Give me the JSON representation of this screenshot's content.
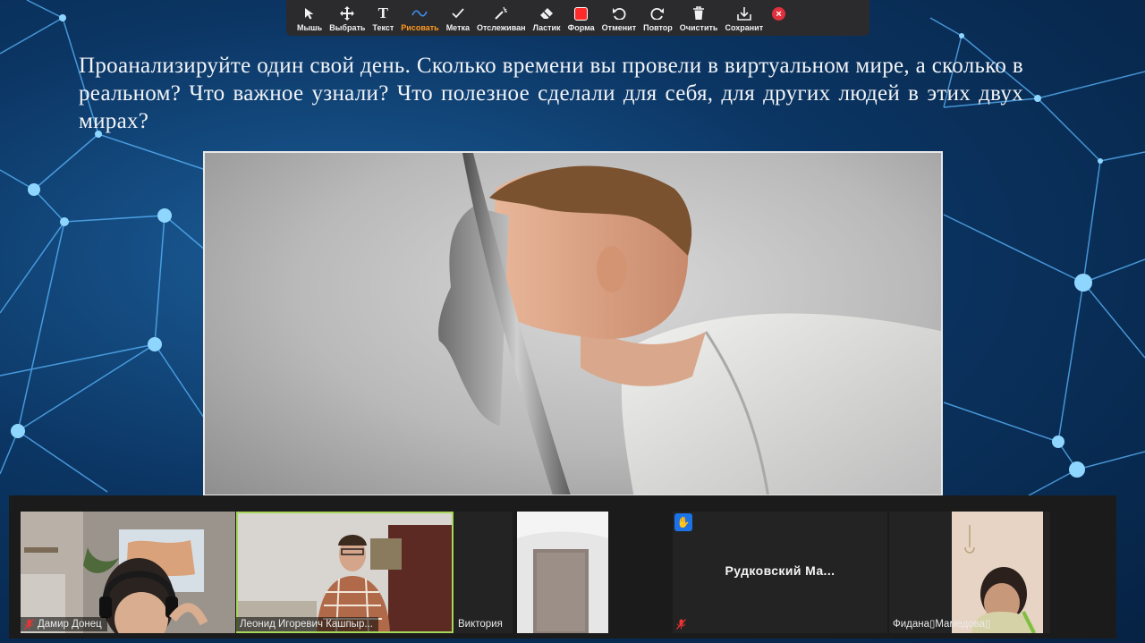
{
  "toolbar": {
    "tools": [
      {
        "label": "Мышь",
        "icon": "mouse-pointer-icon"
      },
      {
        "label": "Выбрать",
        "icon": "move-arrows-icon"
      },
      {
        "label": "Текст",
        "icon": "text-t-icon"
      },
      {
        "label": "Рисовать",
        "icon": "draw-squiggle-icon"
      },
      {
        "label": "Метка",
        "icon": "checkmark-icon"
      },
      {
        "label": "Отслеживан",
        "icon": "spotlight-wand-icon"
      },
      {
        "label": "Ластик",
        "icon": "eraser-icon"
      },
      {
        "label": "Форма",
        "icon": "shape-square-icon"
      },
      {
        "label": "Отменит",
        "icon": "undo-icon"
      },
      {
        "label": "Повтор",
        "icon": "redo-icon"
      },
      {
        "label": "Очистить",
        "icon": "trash-icon"
      },
      {
        "label": "Сохранит",
        "icon": "save-download-icon"
      }
    ],
    "active_tool": "Рисовать",
    "active_label_color": "#ff9a1f",
    "shape_color": "#ff2b2b",
    "close_color": "#e0303d"
  },
  "slide": {
    "text": "Проанализируйте один свой день. Сколько времени вы провели в виртуальном мире, а сколько в реальном? Что важное узнали? Что полезное сделали для  себя, для других людей в этих двух мирах?",
    "background_color": "#0b3563",
    "node_color": "#6ec8ff"
  },
  "gallery": {
    "participants": [
      {
        "name": "Дамир Донец",
        "muted": true
      },
      {
        "name": "Леонид Игоревич Кашпыр...",
        "muted": false,
        "active_speaker": true
      },
      {
        "name": "Виктория",
        "muted": false
      },
      {
        "name": "",
        "muted": true
      },
      {
        "name": "Рудковский  Ма...",
        "muted": true,
        "raised_hand": true
      },
      {
        "name": "Фидана▯Мамедова▯",
        "muted": false
      }
    ],
    "highlight_color": "#a6d65a"
  }
}
